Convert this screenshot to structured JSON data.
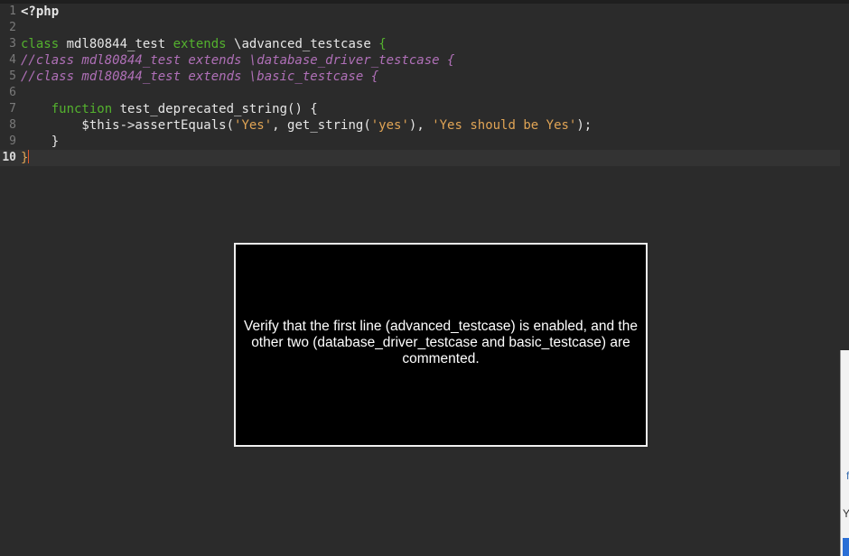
{
  "editor": {
    "lines": [
      {
        "num": "1",
        "segments": [
          {
            "t": "<?php",
            "c": "kw-bold"
          }
        ]
      },
      {
        "num": "2",
        "segments": []
      },
      {
        "num": "3",
        "segments": [
          {
            "t": "class",
            "c": "kw"
          },
          {
            "t": " mdl80844_test ",
            "c": ""
          },
          {
            "t": "extends",
            "c": "kw"
          },
          {
            "t": " \\advanced_testcase ",
            "c": ""
          },
          {
            "t": "{",
            "c": "kw"
          }
        ]
      },
      {
        "num": "4",
        "segments": [
          {
            "t": "//class mdl80844_test extends \\database_driver_testcase {",
            "c": "cm"
          }
        ]
      },
      {
        "num": "5",
        "segments": [
          {
            "t": "//class mdl80844_test extends \\basic_testcase {",
            "c": "cm"
          }
        ]
      },
      {
        "num": "6",
        "segments": []
      },
      {
        "num": "7",
        "segments": [
          {
            "t": "    ",
            "c": ""
          },
          {
            "t": "function",
            "c": "kw"
          },
          {
            "t": " test_deprecated_string() {",
            "c": ""
          }
        ]
      },
      {
        "num": "8",
        "segments": [
          {
            "t": "        $this->assertEquals(",
            "c": ""
          },
          {
            "t": "'Yes'",
            "c": "str"
          },
          {
            "t": ", get_string(",
            "c": ""
          },
          {
            "t": "'yes'",
            "c": "str"
          },
          {
            "t": "), ",
            "c": ""
          },
          {
            "t": "'Yes should be Yes'",
            "c": "str"
          },
          {
            "t": ");",
            "c": ""
          }
        ]
      },
      {
        "num": "9",
        "segments": [
          {
            "t": "    }",
            "c": ""
          }
        ]
      },
      {
        "num": "10",
        "segments": [
          {
            "t": "}",
            "c": "brace-orange"
          }
        ],
        "current": true
      }
    ]
  },
  "right_panel": {
    "fragment_1": "fi",
    "fragment_2": "Yo"
  },
  "overlay": {
    "message": "Verify that the first line (advanced_testcase) is enabled, and the other two (database_driver_testcase and basic_testcase) are commented."
  },
  "colors": {
    "background": "#2b2b2b",
    "keyword": "#54b22e",
    "comment": "#b070b8",
    "string": "#e0a455",
    "cursor": "#e05a2a"
  }
}
